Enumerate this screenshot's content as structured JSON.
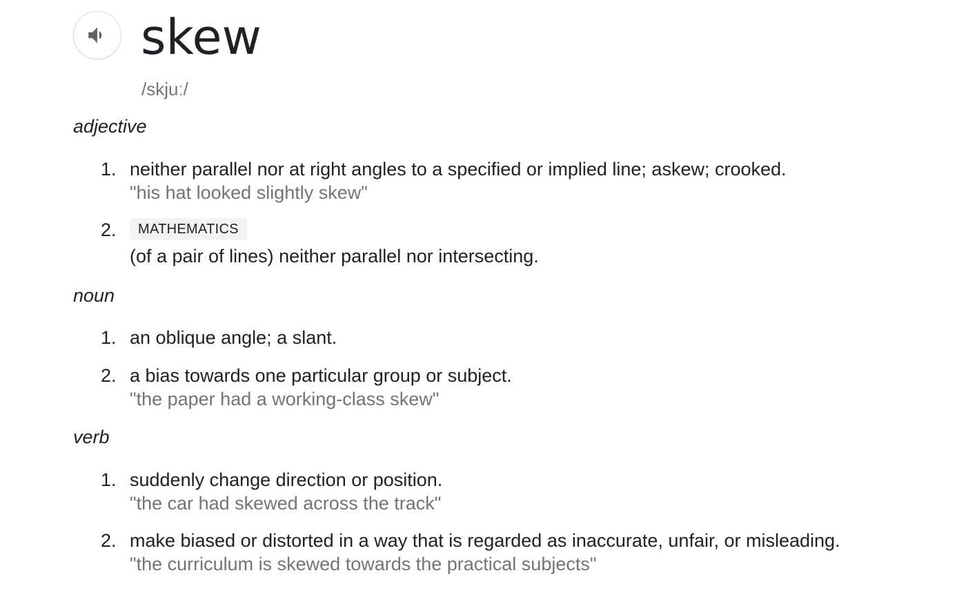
{
  "entry": {
    "word": "skew",
    "phonetic": "/skjuː/",
    "audio_icon": "speaker-icon"
  },
  "adjective": {
    "label": "adjective",
    "senses": [
      {
        "number": "1.",
        "definition": "neither parallel nor at right angles to a specified or implied line; askew; crooked.",
        "example": "\"his hat looked slightly skew\""
      },
      {
        "number": "2.",
        "domain": "MATHEMATICS",
        "definition": "(of a pair of lines) neither parallel nor intersecting."
      }
    ]
  },
  "noun": {
    "label": "noun",
    "senses": [
      {
        "number": "1.",
        "definition": "an oblique angle; a slant."
      },
      {
        "number": "2.",
        "definition": "a bias towards one particular group or subject.",
        "example": "\"the paper had a working-class skew\""
      }
    ]
  },
  "verb": {
    "label": "verb",
    "senses": [
      {
        "number": "1.",
        "definition": "suddenly change direction or position.",
        "example": "\"the car had skewed across the track\""
      },
      {
        "number": "2.",
        "definition": "make biased or distorted in a way that is regarded as inaccurate, unfair, or misleading.",
        "example": "\"the curriculum is skewed towards the practical subjects\""
      }
    ]
  }
}
